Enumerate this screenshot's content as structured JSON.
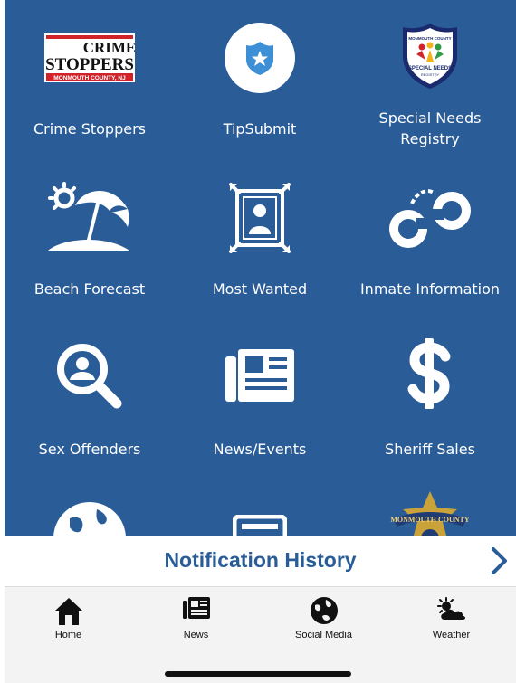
{
  "tiles": [
    {
      "label": "Crime Stoppers",
      "icon": "crime-stoppers-logo"
    },
    {
      "label": "TipSubmit",
      "icon": "police-badge-icon"
    },
    {
      "label": "Special Needs Registry",
      "icon": "special-needs-registry-logo"
    },
    {
      "label": "Beach Forecast",
      "icon": "beach-umbrella-icon"
    },
    {
      "label": "Most Wanted",
      "icon": "wanted-poster-icon"
    },
    {
      "label": "Inmate Information",
      "icon": "handcuffs-icon"
    },
    {
      "label": "Sex Offenders",
      "icon": "search-person-icon"
    },
    {
      "label": "News/Events",
      "icon": "newspaper-icon"
    },
    {
      "label": "Sheriff Sales",
      "icon": "dollar-icon"
    }
  ],
  "logos": {
    "crime_stoppers": {
      "line1": "CRIME",
      "line2": "STOPPERS",
      "line3": "MONMOUTH COUNTY, NJ"
    },
    "special_needs": {
      "top": "MONMOUTH COUNTY",
      "middle": "SPECIAL NEEDS",
      "bottom": "REGISTRY"
    },
    "sheriff_badge": {
      "text": "MONMOUTH COUNTY"
    }
  },
  "notification": {
    "title": "Notification History"
  },
  "tabs": [
    {
      "label": "Home",
      "icon": "home-icon"
    },
    {
      "label": "News",
      "icon": "newspaper-icon"
    },
    {
      "label": "Social Media",
      "icon": "globe-icon"
    },
    {
      "label": "Weather",
      "icon": "sun-cloud-icon"
    }
  ],
  "colors": {
    "primary": "#2a5c98",
    "tab_bar": "#f3f3f3",
    "crime_red": "#d2232a"
  }
}
